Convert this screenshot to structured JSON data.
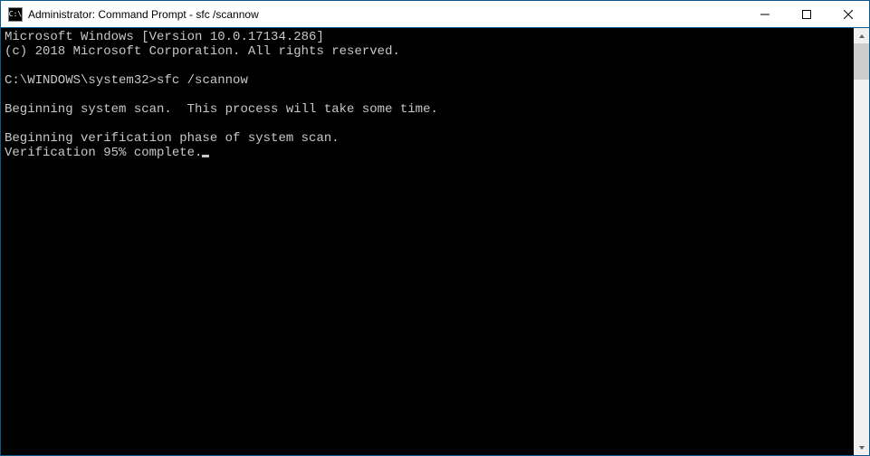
{
  "window": {
    "title": "Administrator: Command Prompt - sfc  /scannow",
    "icon_label": "C:\\"
  },
  "console": {
    "line1": "Microsoft Windows [Version 10.0.17134.286]",
    "line2": "(c) 2018 Microsoft Corporation. All rights reserved.",
    "blank1": "",
    "prompt_path": "C:\\WINDOWS\\system32>",
    "command": "sfc /scannow",
    "blank2": "",
    "line3": "Beginning system scan.  This process will take some time.",
    "blank3": "",
    "line4": "Beginning verification phase of system scan.",
    "line5": "Verification 95% complete."
  }
}
